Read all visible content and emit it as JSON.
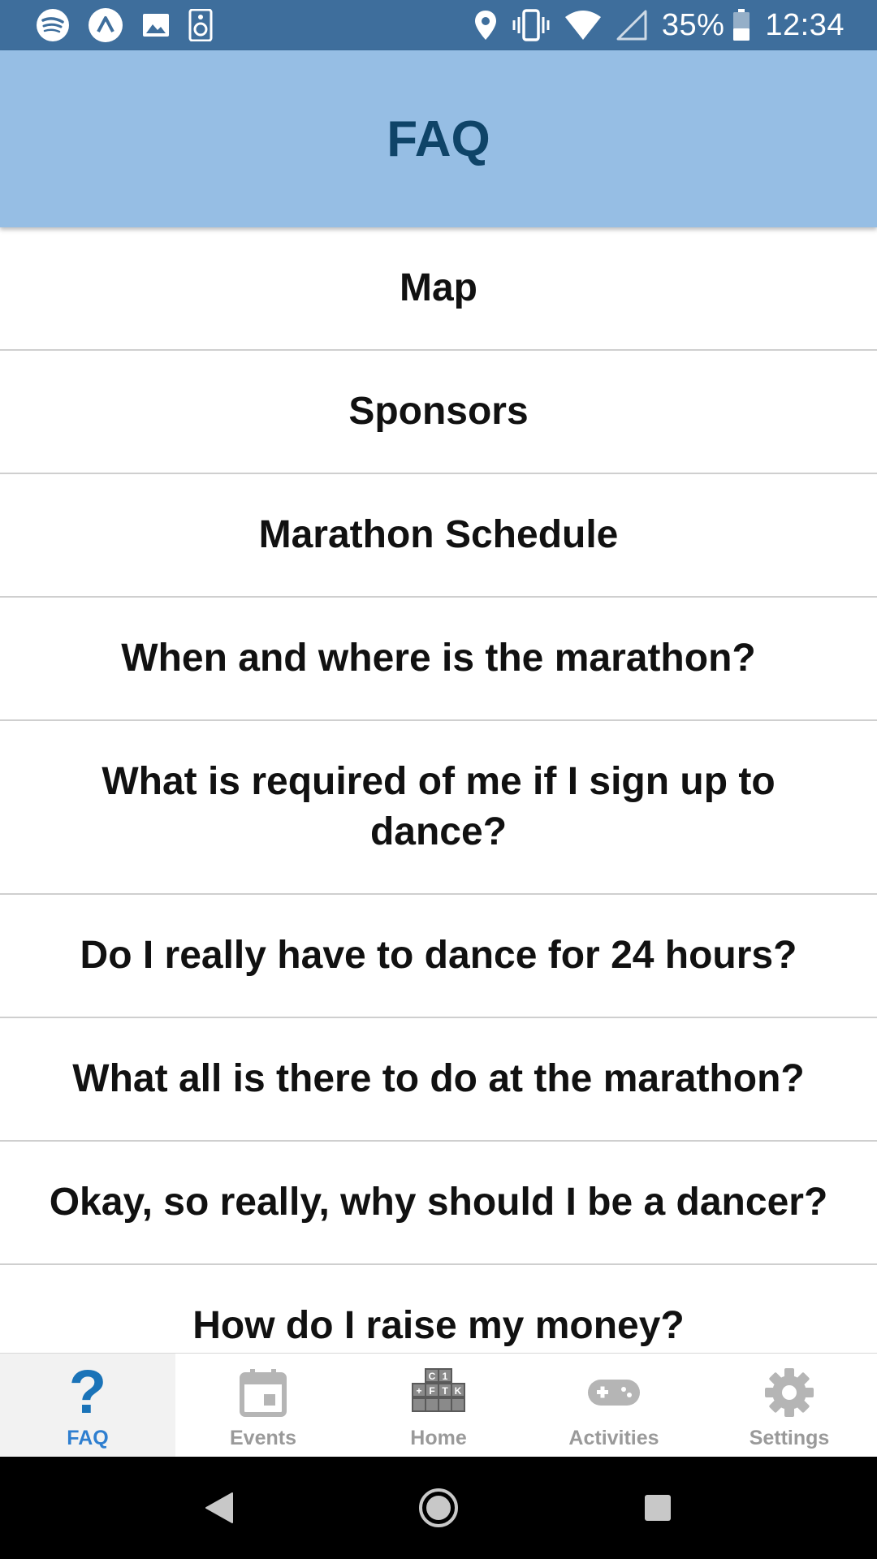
{
  "status_bar": {
    "left_icons": [
      "spotify-icon",
      "app-notification-icon",
      "image-icon",
      "speaker-icon"
    ],
    "right_icons": [
      "location-icon",
      "vibrate-icon",
      "wifi-icon",
      "cell-signal-icon"
    ],
    "battery": "35%",
    "time": "12:34"
  },
  "header": {
    "title": "FAQ"
  },
  "faq_items": [
    "Map",
    "Sponsors",
    "Marathon Schedule",
    "When and where is the marathon?",
    "What is required of me if I sign up to dance?",
    "Do I really have to dance for 24 hours?",
    "What all is there to do at the marathon?",
    "Okay, so really, why should I be a dancer?",
    "How do I raise my money?"
  ],
  "tabs": [
    {
      "label": "FAQ",
      "icon": "question-icon",
      "active": true
    },
    {
      "label": "Events",
      "icon": "calendar-icon",
      "active": false
    },
    {
      "label": "Home",
      "icon": "blocks-icon",
      "active": false
    },
    {
      "label": "Activities",
      "icon": "gamepad-icon",
      "active": false
    },
    {
      "label": "Settings",
      "icon": "gear-icon",
      "active": false
    }
  ],
  "colors": {
    "status_bar": "#3e6e9c",
    "header_bg": "#96bee4",
    "header_title": "#0f4468",
    "tab_active": "#2f7fd0",
    "tab_inactive": "#9a9a9a"
  }
}
